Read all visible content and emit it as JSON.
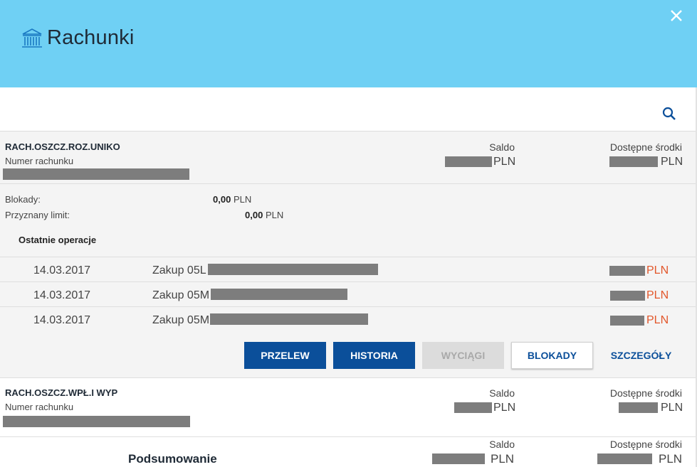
{
  "header": {
    "title": "Rachunki",
    "icon": "bank-icon",
    "close_icon": "close-icon",
    "bg_color": "#6fd0f4"
  },
  "search": {
    "icon": "search-icon"
  },
  "account1": {
    "name": "RACH.OSZCZ.ROZ.UNIKO",
    "number_label": "Numer rachunku",
    "saldo_label": "Saldo",
    "available_label": "Dostępne środki",
    "saldo_currency": "PLN",
    "available_currency": "PLN",
    "blocks_label": "Blokady:",
    "blocks_value": "0,00",
    "blocks_currency": "PLN",
    "limit_label": "Przyznany limit:",
    "limit_value": "0,00",
    "limit_currency": "PLN",
    "recent_ops_title": "Ostatnie operacje",
    "operations": [
      {
        "date": "14.03.2017",
        "desc": "Zakup 05L",
        "currency": "PLN"
      },
      {
        "date": "14.03.2017",
        "desc": "Zakup 05M",
        "currency": "PLN"
      },
      {
        "date": "14.03.2017",
        "desc": "Zakup 05M",
        "currency": "PLN"
      }
    ],
    "buttons": {
      "przelew": "PRZELEW",
      "historia": "HISTORIA",
      "wyciagi": "WYCIĄGI",
      "blokady": "BLOKADY",
      "szczegoly": "SZCZEGÓŁY"
    }
  },
  "account2": {
    "name": "RACH.OSZCZ.WPŁ.I WYP",
    "number_label": "Numer rachunku",
    "saldo_label": "Saldo",
    "available_label": "Dostępne środki",
    "saldo_currency": "PLN",
    "available_currency": "PLN"
  },
  "summary": {
    "title": "Podsumowanie",
    "saldo_label": "Saldo",
    "available_label": "Dostępne środki",
    "saldo_currency": "PLN",
    "available_currency": "PLN"
  },
  "colors": {
    "accent": "#0b4f9a",
    "negative": "#e2572b",
    "masked": "#7d7d7d"
  }
}
